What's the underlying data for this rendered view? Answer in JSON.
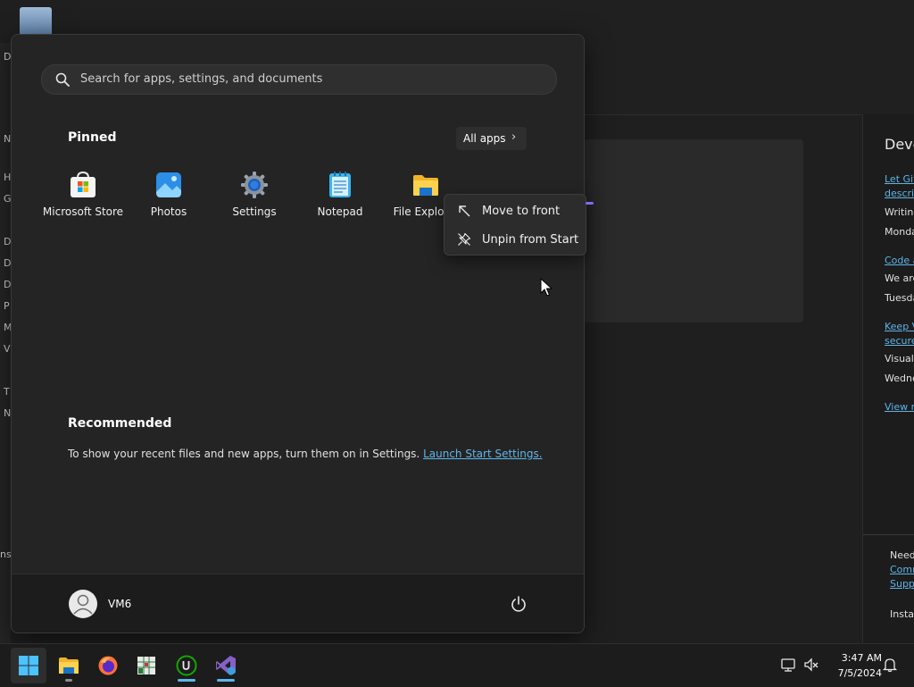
{
  "search": {
    "placeholder": "Search for apps, settings, and documents"
  },
  "pinned": {
    "title": "Pinned",
    "all_apps_label": "All apps",
    "items": [
      {
        "label": "Microsoft Store",
        "icon": "microsoft-store-icon"
      },
      {
        "label": "Photos",
        "icon": "photos-icon"
      },
      {
        "label": "Settings",
        "icon": "settings-gear-icon"
      },
      {
        "label": "Notepad",
        "icon": "notepad-icon"
      },
      {
        "label": "File Explo",
        "icon": "file-explorer-icon"
      }
    ]
  },
  "context_menu": {
    "items": [
      {
        "label": "Move to front",
        "icon": "move-to-front-arrow-icon"
      },
      {
        "label": "Unpin from Start",
        "icon": "unpin-icon"
      }
    ]
  },
  "recommended": {
    "title": "Recommended",
    "text": "To show your recent files and new apps, turn them on in Settings.",
    "link": "Launch Start Settings."
  },
  "user": {
    "name": "VM6"
  },
  "background_window": {
    "left_chars": [
      "De",
      "N",
      "H",
      "G",
      "D",
      "D",
      "D",
      "P",
      "M",
      "V",
      "T",
      "N",
      "ns"
    ],
    "right_panel": {
      "title": "Deve",
      "lines": [
        {
          "text": "Let Git",
          "link": true
        },
        {
          "text": "descrip",
          "link": true
        },
        {
          "text": "Writing",
          "link": false
        },
        {
          "text": "Monda",
          "link": false
        },
        {
          "text": "Code a",
          "link": true
        },
        {
          "text": "We are",
          "link": false
        },
        {
          "text": "Tuesda",
          "link": false
        },
        {
          "text": "Keep V",
          "link": true
        },
        {
          "text": "secure",
          "link": true
        },
        {
          "text": "Visual",
          "link": false
        },
        {
          "text": "Wedne",
          "link": false
        },
        {
          "text": "View n",
          "link": true
        },
        {
          "text": "Need",
          "link": false
        },
        {
          "text": "Comm",
          "link": true
        },
        {
          "text": "Supp",
          "link": true
        },
        {
          "text": "Instal",
          "link": false
        }
      ]
    }
  },
  "taskbar": {
    "apps": [
      "start-windows-icon",
      "file-explorer-icon",
      "firefox-icon",
      "spreadsheet-app-icon",
      "upwork-icon",
      "visual-studio-icon"
    ],
    "clock": {
      "time": "3:47 AM",
      "date": "7/5/2024"
    }
  },
  "colors": {
    "accent": "#60b6e8",
    "menu_bg": "#242424",
    "taskbar_bg": "#1c1c1c"
  }
}
